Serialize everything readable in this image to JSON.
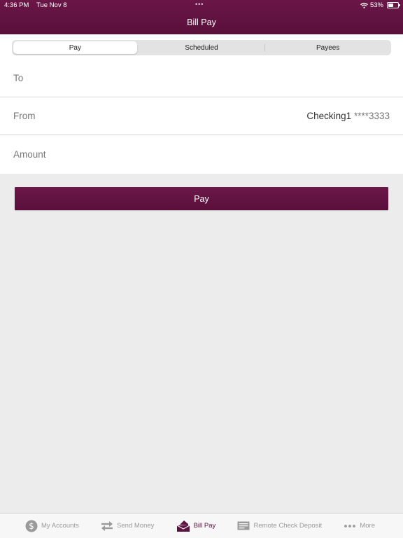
{
  "status_bar": {
    "time": "4:36 PM",
    "date": "Tue Nov 8",
    "multitask_dots": "•••",
    "battery": "53%",
    "battery_level": 0.53
  },
  "header": {
    "title": "Bill Pay"
  },
  "segments": [
    {
      "label": "Pay",
      "active": true
    },
    {
      "label": "Scheduled",
      "active": false
    },
    {
      "label": "Payees",
      "active": false
    }
  ],
  "form": {
    "to": {
      "label": "To",
      "value": ""
    },
    "from": {
      "label": "From",
      "account": "Checking1",
      "mask": "****3333"
    },
    "amount": {
      "label": "Amount",
      "value": ""
    }
  },
  "pay_button": {
    "label": "Pay"
  },
  "tabbar": {
    "items": [
      {
        "label": "My Accounts",
        "icon": "dollar-circle-icon",
        "active": false
      },
      {
        "label": "Send Money",
        "icon": "transfer-arrows-icon",
        "active": false
      },
      {
        "label": "Bill Pay",
        "icon": "envelope-bill-icon",
        "active": true
      },
      {
        "label": "Remote Check Deposit",
        "icon": "check-icon",
        "active": false
      },
      {
        "label": "More",
        "icon": "more-dots-icon",
        "active": false
      }
    ]
  },
  "colors": {
    "brand": "#5e1240",
    "background": "#ececec",
    "muted_text": "#777777"
  }
}
